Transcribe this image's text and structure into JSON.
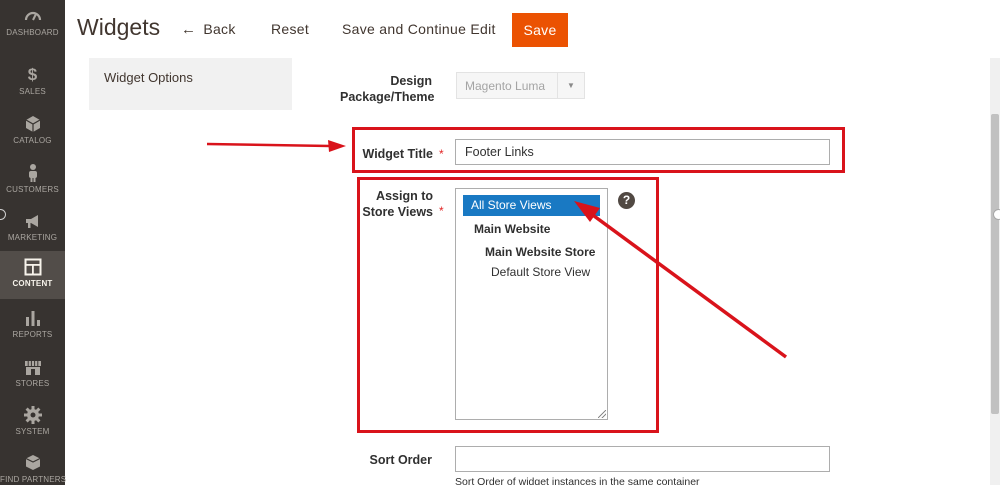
{
  "nav": {
    "items": [
      {
        "label": "DASHBOARD",
        "icon": "dashboard-icon"
      },
      {
        "label": "SALES",
        "icon": "dollar-icon"
      },
      {
        "label": "CATALOG",
        "icon": "cube-icon"
      },
      {
        "label": "CUSTOMERS",
        "icon": "person-icon"
      },
      {
        "label": "MARKETING",
        "icon": "megaphone-icon"
      },
      {
        "label": "CONTENT",
        "icon": "layout-icon",
        "active": true
      },
      {
        "label": "REPORTS",
        "icon": "bar-chart-icon"
      },
      {
        "label": "STORES",
        "icon": "storefront-icon"
      },
      {
        "label": "SYSTEM",
        "icon": "gear-icon"
      },
      {
        "label": "FIND PARTNERS",
        "icon": "box-icon"
      }
    ]
  },
  "header": {
    "title": "Widgets",
    "back_label": "Back",
    "reset_label": "Reset",
    "save_continue_label": "Save and Continue Edit",
    "save_label": "Save"
  },
  "tabs": {
    "widget_options": "Widget Options"
  },
  "form": {
    "design_package": {
      "label": "Design Package/Theme",
      "value": "Magento Luma"
    },
    "widget_title": {
      "label": "Widget Title",
      "value": "Footer Links",
      "required_mark": "*"
    },
    "store_views": {
      "label": "Assign to Store Views",
      "required_mark": "*",
      "options": {
        "all": "All Store Views",
        "website": "Main Website",
        "store": "Main Website Store",
        "view": "Default Store View"
      },
      "help": "?"
    },
    "sort_order": {
      "label": "Sort Order",
      "value": "",
      "note": "Sort Order of widget instances in the same container"
    }
  },
  "colors": {
    "sidebar_bg": "#373330",
    "sidebar_active": "#524d49",
    "save_orange": "#eb5202",
    "selected_blue": "#1979c3",
    "annotation_red": "#d9131b"
  }
}
